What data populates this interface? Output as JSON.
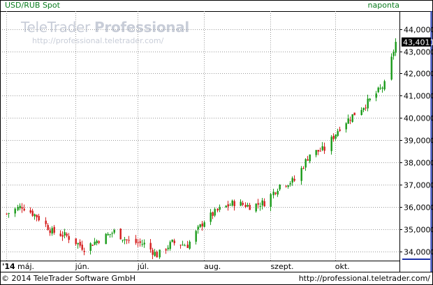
{
  "header": {
    "instrument": "USD/RUB Spot",
    "interval": "naponta"
  },
  "watermark": {
    "brand_prefix": "TeleTrader",
    "brand_suffix": "Professional",
    "url": "http://professional.teletrader.com/"
  },
  "footer": {
    "copyright": "© 2014 TeleTrader Software GmbH",
    "url": "http://professional.teletrader.com/"
  },
  "colors": {
    "up": "#1a9b1a",
    "down": "#d41e1e",
    "grid": "#9a9a9a",
    "accent": "#0b7d1f",
    "price_box": "#000000",
    "frame": "#000000"
  },
  "chart_data": {
    "type": "candlestick",
    "last_price_label": "43,4011",
    "ylim": [
      33.6,
      44.8
    ],
    "y_ticks": [
      "34,0000",
      "35,0000",
      "36,0000",
      "37,0000",
      "38,0000",
      "39,0000",
      "40,0000",
      "41,0000",
      "42,0000",
      "43,0000",
      "44,0000"
    ],
    "y_tick_values": [
      34,
      35,
      36,
      37,
      38,
      39,
      40,
      41,
      42,
      43,
      44
    ],
    "x_labels": [
      "'14",
      "máj.",
      "jún.",
      "júl.",
      "aug.",
      "szept.",
      "okt."
    ],
    "x_label_dates": [
      "2014-05-01",
      "2014-05-01",
      "2014-06-02",
      "2014-07-01",
      "2014-08-01",
      "2014-09-01",
      "2014-10-01"
    ],
    "key_points": [
      {
        "date": "2014-05-01",
        "close": 35.7
      },
      {
        "date": "2014-05-08",
        "close": 36.05
      },
      {
        "date": "2014-05-15",
        "close": 35.6
      },
      {
        "date": "2014-05-22",
        "close": 34.9
      },
      {
        "date": "2014-05-29",
        "close": 34.7
      },
      {
        "date": "2014-06-06",
        "close": 34.15
      },
      {
        "date": "2014-06-13",
        "close": 34.55
      },
      {
        "date": "2014-06-20",
        "close": 34.9
      },
      {
        "date": "2014-06-27",
        "close": 34.45
      },
      {
        "date": "2014-07-04",
        "close": 34.35
      },
      {
        "date": "2014-07-10",
        "close": 33.85
      },
      {
        "date": "2014-07-17",
        "close": 34.4
      },
      {
        "date": "2014-07-24",
        "close": 34.3
      },
      {
        "date": "2014-08-01",
        "close": 35.4
      },
      {
        "date": "2014-08-08",
        "close": 35.9
      },
      {
        "date": "2014-08-15",
        "close": 36.2
      },
      {
        "date": "2014-08-22",
        "close": 36.05
      },
      {
        "date": "2014-08-29",
        "close": 36.2
      },
      {
        "date": "2014-09-05",
        "close": 37.0
      },
      {
        "date": "2014-09-12",
        "close": 37.2
      },
      {
        "date": "2014-09-19",
        "close": 38.4
      },
      {
        "date": "2014-09-26",
        "close": 38.6
      },
      {
        "date": "2014-10-03",
        "close": 39.6
      },
      {
        "date": "2014-10-10",
        "close": 40.2
      },
      {
        "date": "2014-10-17",
        "close": 40.8
      },
      {
        "date": "2014-10-24",
        "close": 41.5
      },
      {
        "date": "2014-10-29",
        "close": 43.4
      }
    ]
  }
}
